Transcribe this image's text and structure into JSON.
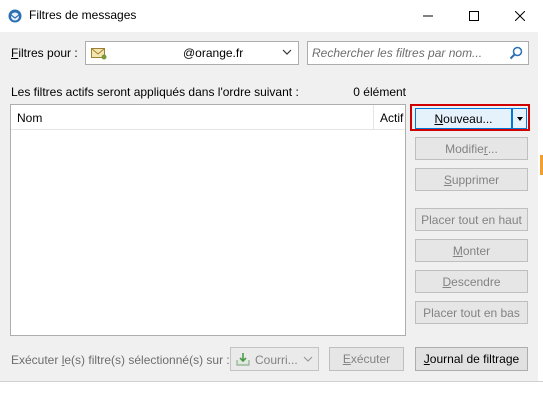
{
  "window": {
    "title": "Filtres de messages",
    "minimize_glyph": "—",
    "maximize_glyph": "☐",
    "close_glyph": "✕"
  },
  "filters_for": {
    "label_prefix": "F",
    "label_rest": "iltres pour :",
    "account_value": "@orange.fr",
    "account_icon": "mail-account-icon"
  },
  "search": {
    "placeholder": "Rechercher les filtres par nom...",
    "icon": "search-icon"
  },
  "list": {
    "order_text": "Les filtres actifs seront appliqués dans l'ordre suivant :",
    "count_text": "0 élément",
    "columns": [
      "Nom",
      "Actif"
    ],
    "rows": []
  },
  "buttons": {
    "new_prefix": "N",
    "new_rest": "ouveau...",
    "modify_prefix": "Modifie",
    "modify_u": "r",
    "modify_rest": "...",
    "delete_u": "S",
    "delete_rest": "upprimer",
    "top_label": "Placer tout en haut",
    "up_u": "M",
    "up_rest": "onter",
    "down_u": "D",
    "down_rest": "escendre",
    "bottom_label": "Placer tout en bas",
    "run_u": "E",
    "run_rest": "xécuter",
    "log_u": "J",
    "log_rest": "ournal de filtrage"
  },
  "bottom": {
    "run_label_pre": "Exécuter ",
    "run_label_u": "l",
    "run_label_rest": "e(s) filtre(s) sélectionné(s) sur :",
    "folder_value": "Courri...",
    "folder_icon": "inbox-download-icon"
  },
  "colors": {
    "highlight_border": "#d00000",
    "focus_blue": "#0078d7",
    "disabled_text": "#838383"
  }
}
